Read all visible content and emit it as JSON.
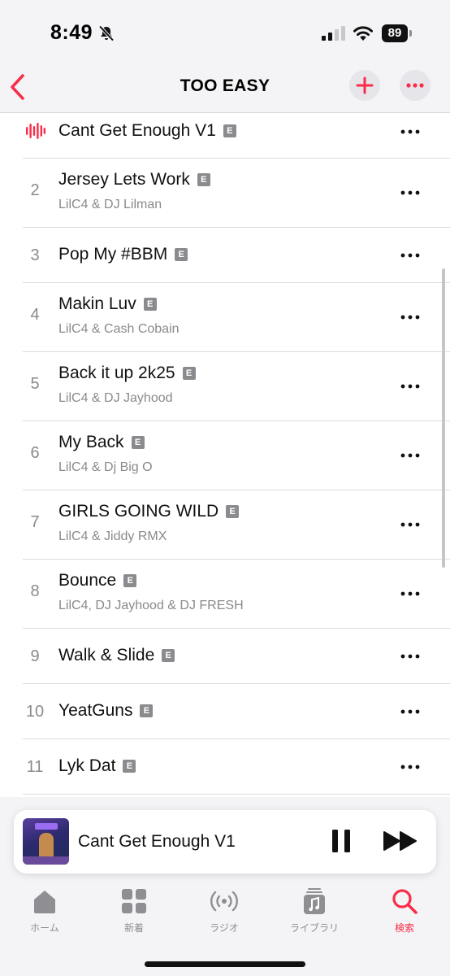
{
  "status_bar": {
    "time": "8:49",
    "battery": "89"
  },
  "header": {
    "title": "TOO EASY"
  },
  "explicit_badge": "E",
  "tracks": [
    {
      "number": "",
      "title": "Cant Get Enough V1",
      "artist": "",
      "playing": true
    },
    {
      "number": "2",
      "title": "Jersey Lets Work",
      "artist": "LilC4 & DJ Lilman"
    },
    {
      "number": "3",
      "title": "Pop My #BBM",
      "artist": ""
    },
    {
      "number": "4",
      "title": "Makin Luv",
      "artist": "LilC4 & Cash Cobain"
    },
    {
      "number": "5",
      "title": "Back it up 2k25",
      "artist": "LilC4 & DJ Jayhood"
    },
    {
      "number": "6",
      "title": "My Back",
      "artist": "LilC4 & Dj Big O"
    },
    {
      "number": "7",
      "title": "GIRLS GOING WILD",
      "artist": "LilC4 & Jiddy RMX"
    },
    {
      "number": "8",
      "title": "Bounce",
      "artist": "LilC4, DJ Jayhood & DJ FRESH"
    },
    {
      "number": "9",
      "title": "Walk & Slide",
      "artist": ""
    },
    {
      "number": "10",
      "title": "YeatGuns",
      "artist": ""
    },
    {
      "number": "11",
      "title": "Lyk Dat",
      "artist": ""
    }
  ],
  "mini_player": {
    "title": "Cant Get Enough V1"
  },
  "tabs": [
    {
      "label": "ホーム",
      "icon": "home-icon",
      "active": false
    },
    {
      "label": "新着",
      "icon": "grid-icon",
      "active": false
    },
    {
      "label": "ラジオ",
      "icon": "radio-icon",
      "active": false
    },
    {
      "label": "ライブラリ",
      "icon": "library-icon",
      "active": false
    },
    {
      "label": "検索",
      "icon": "search-icon",
      "active": true
    }
  ],
  "colors": {
    "accent": "#fa2d48",
    "secondary_text": "#8a8a8e",
    "bar_background": "#f4f4f6"
  }
}
